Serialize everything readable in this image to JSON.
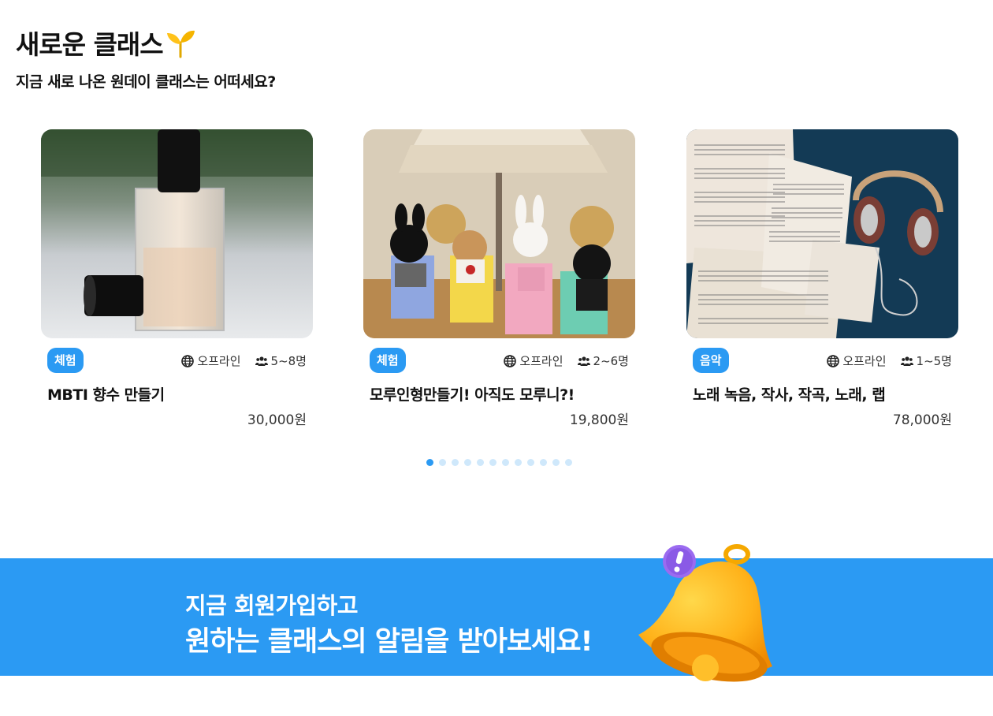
{
  "section": {
    "title": "새로운 클래스",
    "subtitle": "지금 새로 나온 원데이 클래스는 어떠세요?"
  },
  "cards": [
    {
      "category": "체험",
      "mode": "오프라인",
      "people": "5~8명",
      "title": "MBTI 향수 만들기",
      "price": "30,000원"
    },
    {
      "category": "체험",
      "mode": "오프라인",
      "people": "2~6명",
      "title": "모루인형만들기! 아직도 모루니?!",
      "price": "19,800원"
    },
    {
      "category": "음악",
      "mode": "오프라인",
      "people": "1~5명",
      "title": "노래 녹음, 작사, 작곡, 노래, 랩",
      "price": "78,000원"
    }
  ],
  "pagination": {
    "total": 12,
    "active": 1
  },
  "banner": {
    "line1": "지금 회원가입하고",
    "line2": "원하는 클래스의 알림을 받아보세요!"
  },
  "colors": {
    "accent": "#2b9af3",
    "badge_text": "#ffffff"
  },
  "icons": {
    "mode": "globe-icon",
    "people": "users-icon",
    "title_decoration": "sprout-icon",
    "banner": "bell-icon"
  }
}
